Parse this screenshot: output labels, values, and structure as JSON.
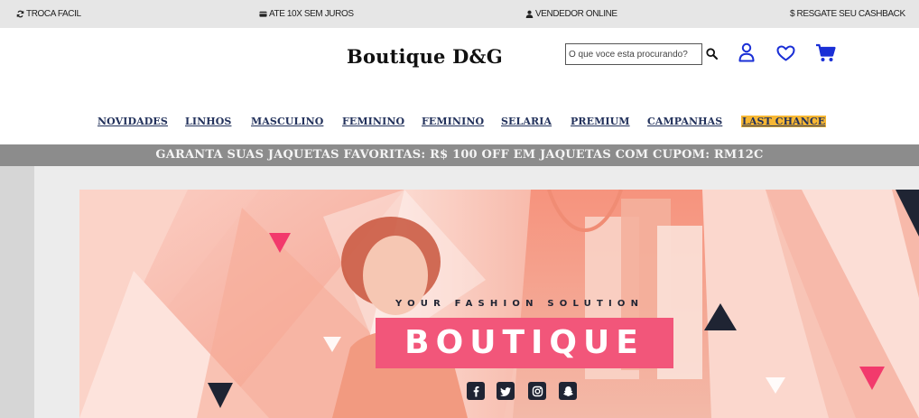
{
  "topbar": {
    "exchange": "TROCA FACIL",
    "installments": "ATE 10X SEM JUROS",
    "seller": "VENDEDOR ONLINE",
    "cashback": "$ RESGATE SEU CASHBACK"
  },
  "header": {
    "brand": "Boutique D&G",
    "search_placeholder": "O que voce esta procurando?"
  },
  "nav": {
    "items": [
      "NOVIDADES",
      "LINHOS",
      "MASCULINO",
      "FEMININO",
      "FEMININO",
      "SELARIA",
      "PREMIUM",
      "CAMPANHAS",
      "LAST CHANCE"
    ]
  },
  "promo": {
    "text": "GARANTA SUAS JAQUETAS FAVORITAS: R$ 100 OFF EM JAQUETAS COM CUPOM: RM12C"
  },
  "hero": {
    "tagline": "YOUR FASHION SOLUTION",
    "title": "BOUTIQUE",
    "social": [
      "facebook-icon",
      "twitter-icon",
      "instagram-icon",
      "snapchat-icon"
    ]
  },
  "colors": {
    "accent": "#f2567a",
    "nav_text": "#23325c",
    "highlight": "#f7b733",
    "icon_blue": "#1a2fd6",
    "promo_bg": "#8c8c8c"
  }
}
